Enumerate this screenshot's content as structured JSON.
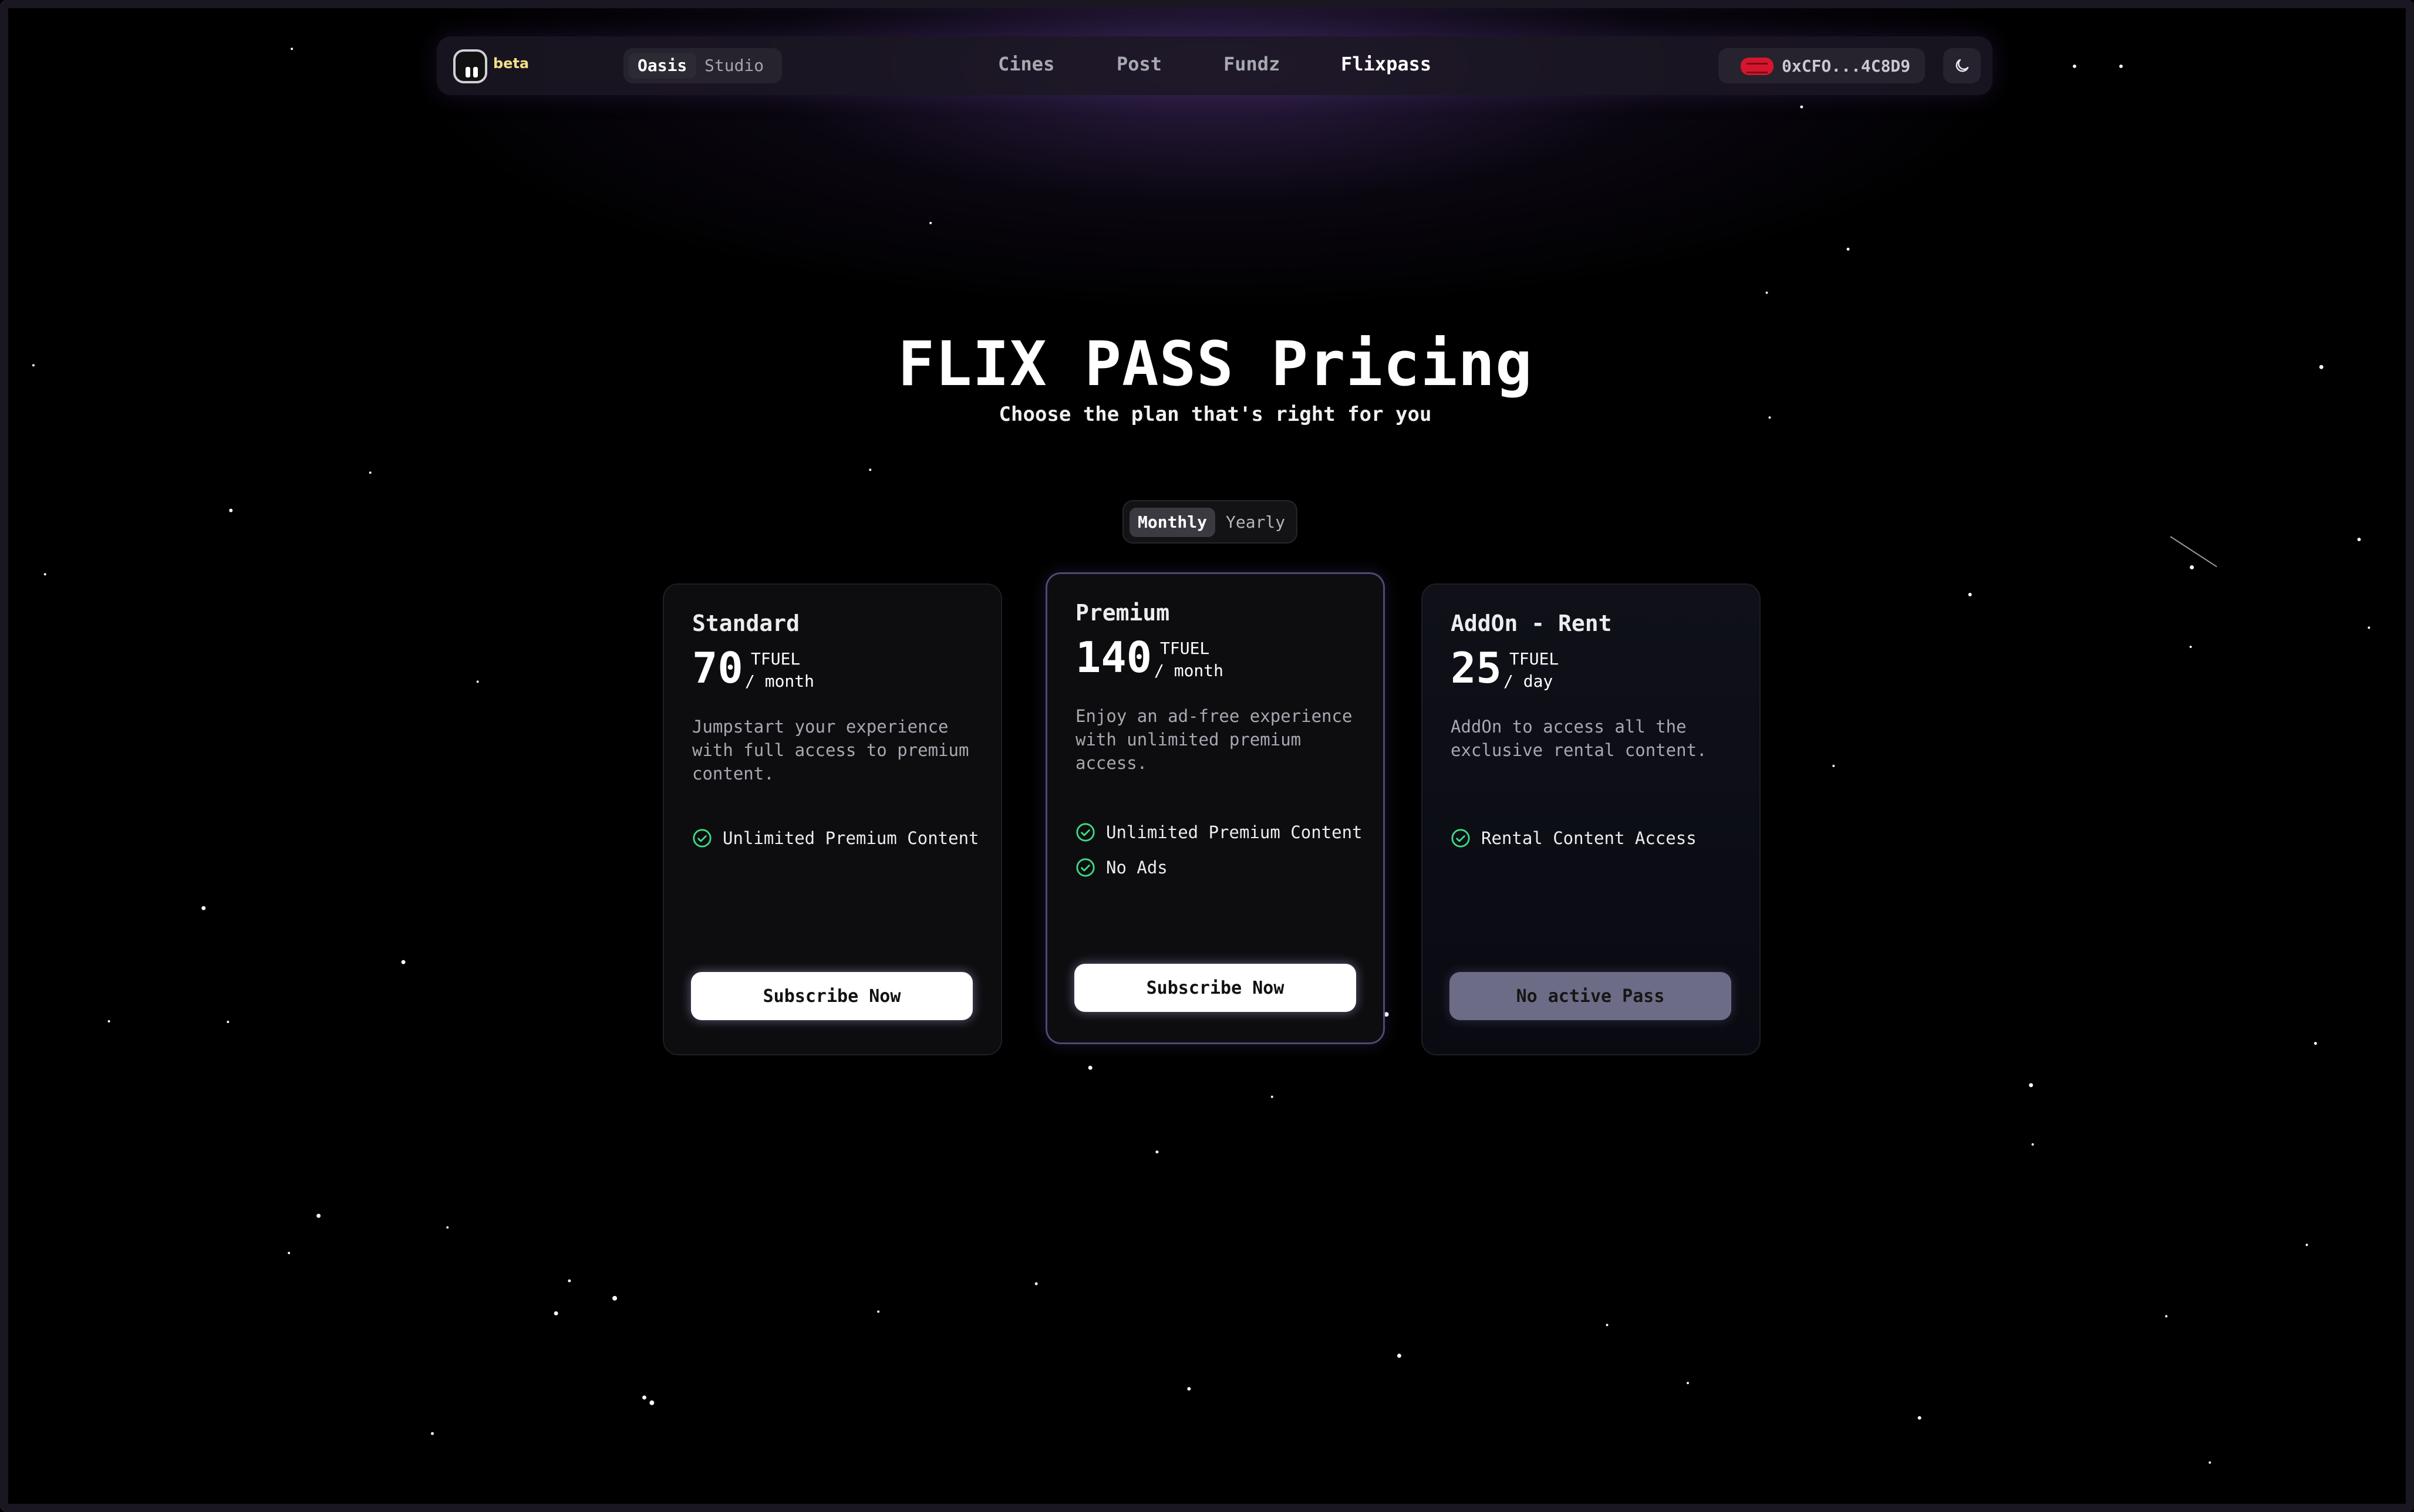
{
  "header": {
    "badge": "beta",
    "modes": [
      "Oasis",
      "Studio"
    ],
    "links": [
      "Cines",
      "Post",
      "Fundz",
      "Flixpass"
    ],
    "wallet_address": "0xCFO...4C8D9",
    "theme_icon": "moon-icon"
  },
  "hero": {
    "title": "FLIX PASS Pricing",
    "subtitle": "Choose the plan that's right for you"
  },
  "billing_toggle": {
    "options": [
      "Monthly",
      "Yearly"
    ],
    "selected": "Monthly"
  },
  "plans": [
    {
      "name": "Standard",
      "price": "70",
      "currency": "TFUEL",
      "period": "/ month",
      "description": "Jumpstart your experience with full access to premium content.",
      "features": [
        "Unlimited Premium Content"
      ],
      "cta": "Subscribe Now"
    },
    {
      "name": "Premium",
      "price": "140",
      "currency": "TFUEL",
      "period": "/ month",
      "description": "Enjoy an ad-free experience with unlimited premium access.",
      "features": [
        "Unlimited Premium Content",
        "No Ads"
      ],
      "cta": "Subscribe Now"
    },
    {
      "name": "AddOn - Rent",
      "price": "25",
      "currency": "TFUEL",
      "period": "/ day",
      "description": "AddOn to access all the exclusive rental content.",
      "features": [
        "Rental Content Access"
      ],
      "cta": "No active Pass"
    }
  ],
  "colors": {
    "accent_check": "#3ddc84",
    "featured_border": "#4e4878",
    "wallet_red": "#d6152f",
    "beta_yellow": "#f3e08a"
  }
}
